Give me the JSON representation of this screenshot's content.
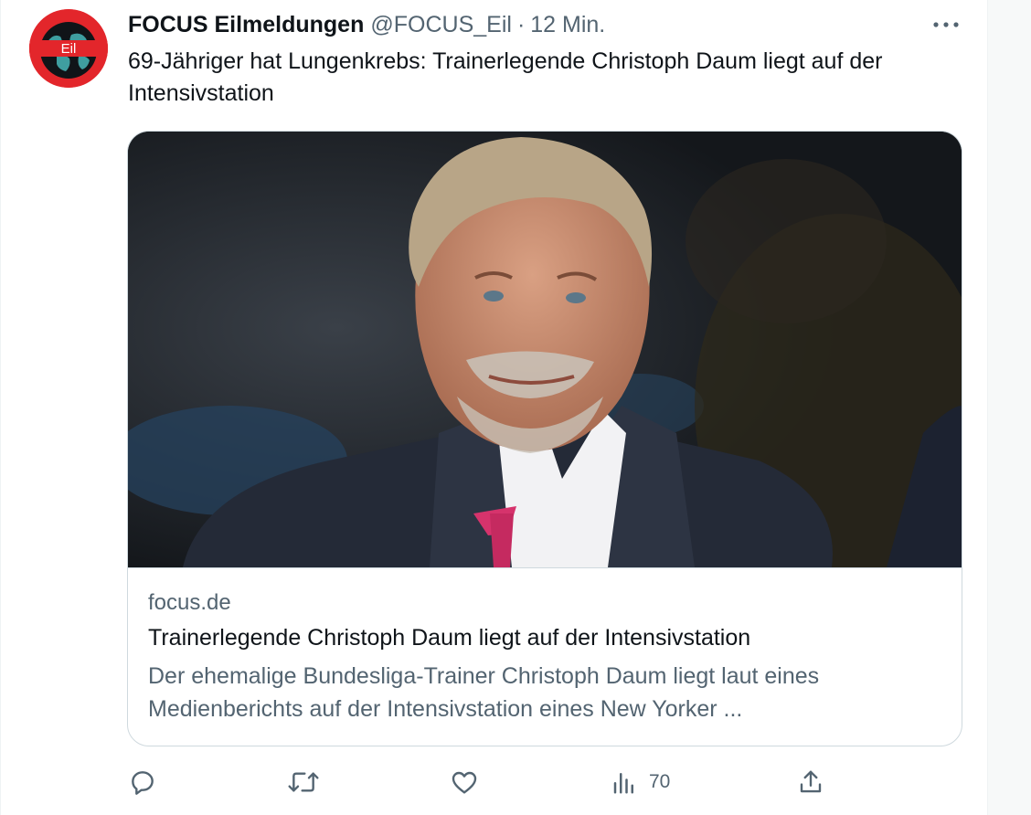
{
  "tweet": {
    "display_name": "FOCUS Eilmeldungen",
    "handle": "@FOCUS_Eil",
    "separator": "·",
    "time": "12 Min.",
    "avatar_label": "Eil",
    "text": "69-Jähriger hat Lungenkrebs: Trainerlegende Christoph Daum liegt auf der Intensivstation"
  },
  "card": {
    "domain": "focus.de",
    "title": "Trainerlegende Christoph Daum liegt auf der Intensivstation",
    "description": "Der ehemalige Bundesliga-Trainer Christoph Daum liegt laut eines Medienberichts auf der Intensivstation eines New Yorker ..."
  },
  "actions": {
    "views_count": "70"
  },
  "icons": {
    "more": "more-icon",
    "reply": "reply-icon",
    "retweet": "retweet-icon",
    "like": "like-icon",
    "views": "views-icon",
    "share": "share-icon"
  },
  "colors": {
    "text_primary": "#0f1419",
    "text_secondary": "#536471",
    "border": "#cfd9de",
    "avatar_red": "#e3262b"
  }
}
